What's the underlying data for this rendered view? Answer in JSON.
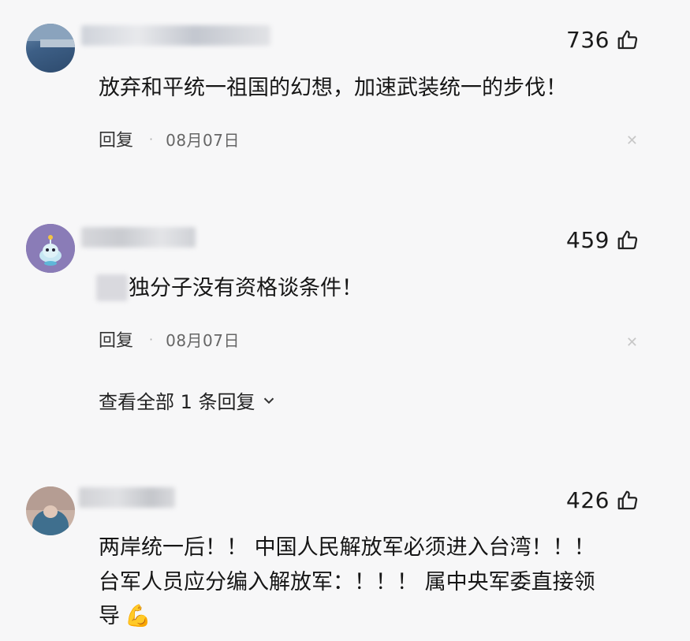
{
  "comments": [
    {
      "likes": "736",
      "text": "放弃和平统一祖国的幻想，加速武装统一的步伐！",
      "reply_label": "回复",
      "date": "08月07日"
    },
    {
      "likes": "459",
      "text": "独分子没有资格谈条件！",
      "reply_label": "回复",
      "date": "08月07日",
      "view_all_replies": "查看全部 1 条回复"
    },
    {
      "likes": "426",
      "text_lines": [
        "两岸统一后！！ 中国人民解放军必须进入台湾！！！",
        "台军人员应分编入解放军：！！！ 属中央军委直接领",
        "导"
      ],
      "emoji": "💪"
    }
  ],
  "icons": {
    "like": "thumbs-up-icon",
    "close": "close-icon",
    "expand": "chevron-down-icon"
  }
}
